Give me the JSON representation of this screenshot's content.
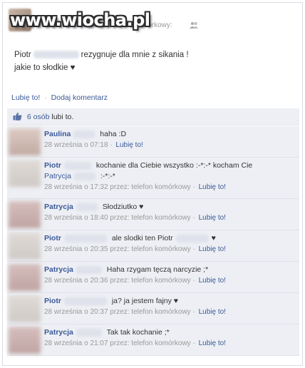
{
  "watermark": "www.wiocha.pl",
  "header": {
    "subtitle": "n komórkowy:"
  },
  "status": {
    "author_first": "Piotr",
    "text_line1": "rezygnuje dla mnie z sikania !",
    "text_line2": "jakie to słodkie ♥"
  },
  "actions": {
    "like": "Lubię to!",
    "comment": "Dodaj komentarz",
    "separator": "·"
  },
  "likes": {
    "count_link": "6 osób",
    "suffix": "lubi to."
  },
  "comments": [
    {
      "name": "Paulina",
      "text": "haha :D",
      "text2": "",
      "time": "28 września o 07:18",
      "via": "",
      "like": "Lubię to!"
    },
    {
      "name": "Piotr",
      "text": "kochanie dla Ciebie wszystko :-*:-* kocham Cie",
      "mention": "Patrycja",
      "text2": ":-*:-*",
      "time": "28 września o 17:32",
      "via": "przez: telefon komórkowy",
      "like": "Lubię to!"
    },
    {
      "name": "Patrycja",
      "text": "Słodziutko ♥",
      "text2": "",
      "time": "28 września o 18:40",
      "via": "przez: telefon komórkowy",
      "like": "Lubię to!"
    },
    {
      "name": "Piotr",
      "text": "ale slodki ten Piotr",
      "text_end": "♥",
      "text2": "",
      "time": "28 września o 20:35",
      "via": "przez: telefon komórkowy",
      "like": "Lubię to!"
    },
    {
      "name": "Patrycja",
      "text": "Haha rzygam tęczą narcyzie ;*",
      "text2": "",
      "time": "28 września o 20:36",
      "via": "przez: telefon komórkowy",
      "like": "Lubię to!"
    },
    {
      "name": "Piotr",
      "text": "ja? ja jestem fajny ♥",
      "text2": "",
      "time": "28 września o 20:37",
      "via": "przez: telefon komórkowy",
      "like": "Lubię to!"
    },
    {
      "name": "Patrycja",
      "text": "Tak tak kochanie ;*",
      "text2": "",
      "time": "28 września o 21:07",
      "via": "przez: telefon komórkowy",
      "like": "Lubię to!"
    }
  ],
  "colors": {
    "link": "#3b5998",
    "panel": "#edeff4",
    "muted": "#999999"
  }
}
